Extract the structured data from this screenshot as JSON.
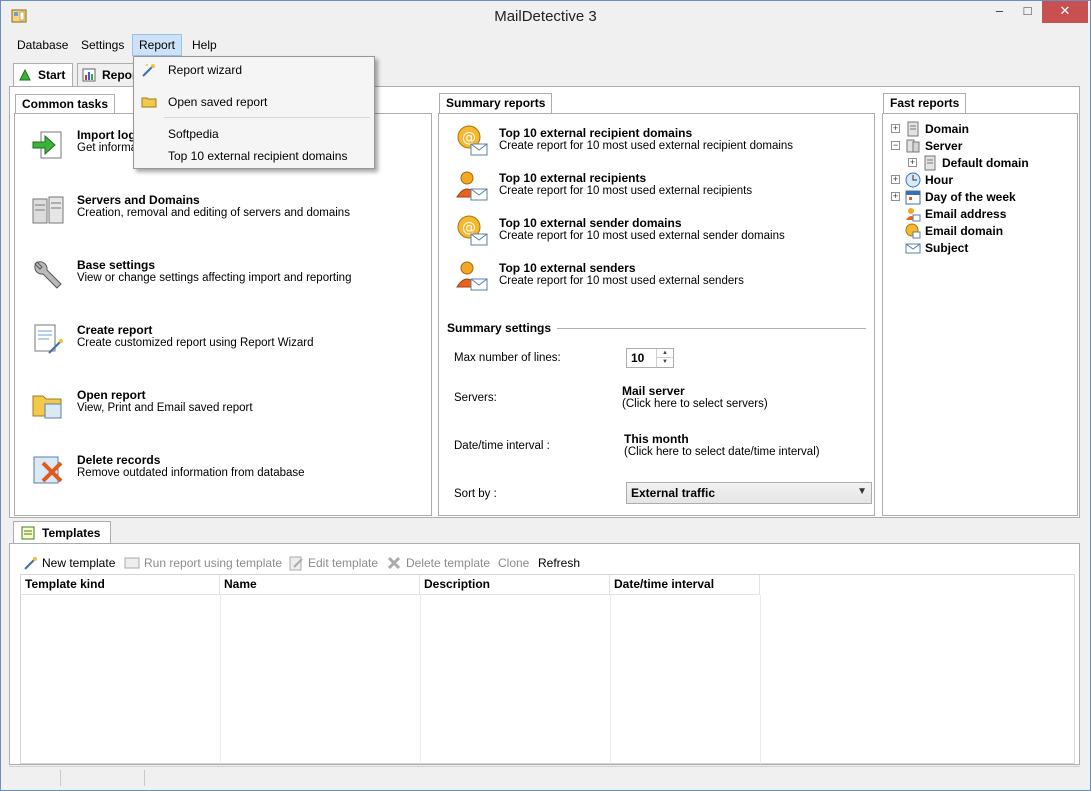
{
  "window": {
    "title": "MailDetective 3",
    "minimize_glyph": "–",
    "maximize_glyph": "□",
    "close_glyph": "✕"
  },
  "menu": {
    "items": [
      "Database",
      "Settings",
      "Report",
      "Help"
    ],
    "active": "Report"
  },
  "report_menu": {
    "items": [
      {
        "label": "Report wizard",
        "icon": "wand-icon"
      },
      {
        "label": "Open saved report",
        "icon": "folder-icon"
      },
      {
        "label": "Softpedia",
        "icon": ""
      },
      {
        "label": "Top 10 external recipient domains",
        "icon": ""
      }
    ]
  },
  "tabs": [
    {
      "label": "Start",
      "icon": "start-icon"
    },
    {
      "label": "Repor",
      "icon": "report-icon"
    }
  ],
  "common_tasks": {
    "header": "Common tasks",
    "items": [
      {
        "title": "Import log",
        "desc": "Get informati",
        "icon": "import-icon"
      },
      {
        "title": "Servers and Domains",
        "desc": "Creation, removal and editing of servers and domains",
        "icon": "servers-icon"
      },
      {
        "title": "Base settings",
        "desc": "View or change settings affecting import and reporting",
        "icon": "wrench-icon"
      },
      {
        "title": "Create report",
        "desc": "Create customized report using Report Wizard",
        "icon": "create-report-icon"
      },
      {
        "title": "Open report",
        "desc": "View, Print and Email saved report",
        "icon": "open-folder-icon"
      },
      {
        "title": "Delete records",
        "desc": "Remove outdated information from database",
        "icon": "delete-icon"
      }
    ]
  },
  "summary_reports": {
    "header": "Summary reports",
    "items": [
      {
        "title": "Top 10 external recipient domains",
        "desc": "Create report for 10 most used external recipient domains",
        "icon": "at-mail-icon"
      },
      {
        "title": "Top 10 external recipients",
        "desc": "Create report for 10 most used external recipients",
        "icon": "person-mail-icon"
      },
      {
        "title": "Top 10 external sender domains",
        "desc": "Create report for 10 most used external sender domains",
        "icon": "at-mail-icon"
      },
      {
        "title": "Top 10 external senders",
        "desc": "Create report for 10 most used external senders",
        "icon": "person-mail-icon"
      }
    ]
  },
  "summary_settings": {
    "header": "Summary settings",
    "max_lines_label": "Max number of lines:",
    "max_lines_value": "10",
    "servers_label": "Servers:",
    "servers_value": "Mail server",
    "servers_hint": "(Click here to select servers)",
    "interval_label": "Date/time interval :",
    "interval_value": "This month",
    "interval_hint": "(Click here to select date/time interval)",
    "sortby_label": "Sort by :",
    "sortby_value": "External traffic"
  },
  "fast_reports": {
    "header": "Fast reports",
    "items": [
      {
        "label": "Domain",
        "expander": "+",
        "icon": "domain-icon"
      },
      {
        "label": "Server",
        "expander": "−",
        "icon": "server-icon"
      },
      {
        "label": "Default domain",
        "expander": "+",
        "icon": "domain-icon"
      },
      {
        "label": "Hour",
        "expander": "+",
        "icon": "clock-icon"
      },
      {
        "label": "Day of the week",
        "expander": "+",
        "icon": "calendar-icon"
      },
      {
        "label": "Email address",
        "expander": "",
        "icon": "person-icon"
      },
      {
        "label": "Email domain",
        "expander": "",
        "icon": "at-icon"
      },
      {
        "label": "Subject",
        "expander": "",
        "icon": "subject-icon"
      }
    ]
  },
  "templates": {
    "tab_label": "Templates",
    "toolbar": [
      {
        "label": "New template",
        "enabled": true,
        "icon": "new-template-icon"
      },
      {
        "label": "Run report using template",
        "enabled": false,
        "icon": "run-report-icon"
      },
      {
        "label": "Edit template",
        "enabled": false,
        "icon": "edit-template-icon"
      },
      {
        "label": "Delete template",
        "enabled": false,
        "icon": "delete-template-icon"
      },
      {
        "label": "Clone",
        "enabled": false,
        "icon": ""
      },
      {
        "label": "Refresh",
        "enabled": true,
        "icon": ""
      }
    ],
    "columns": [
      "Template kind",
      "Name",
      "Description",
      "Date/time interval"
    ]
  },
  "colors": {
    "accent": "#cde2f7",
    "close_button": "#c75050"
  }
}
